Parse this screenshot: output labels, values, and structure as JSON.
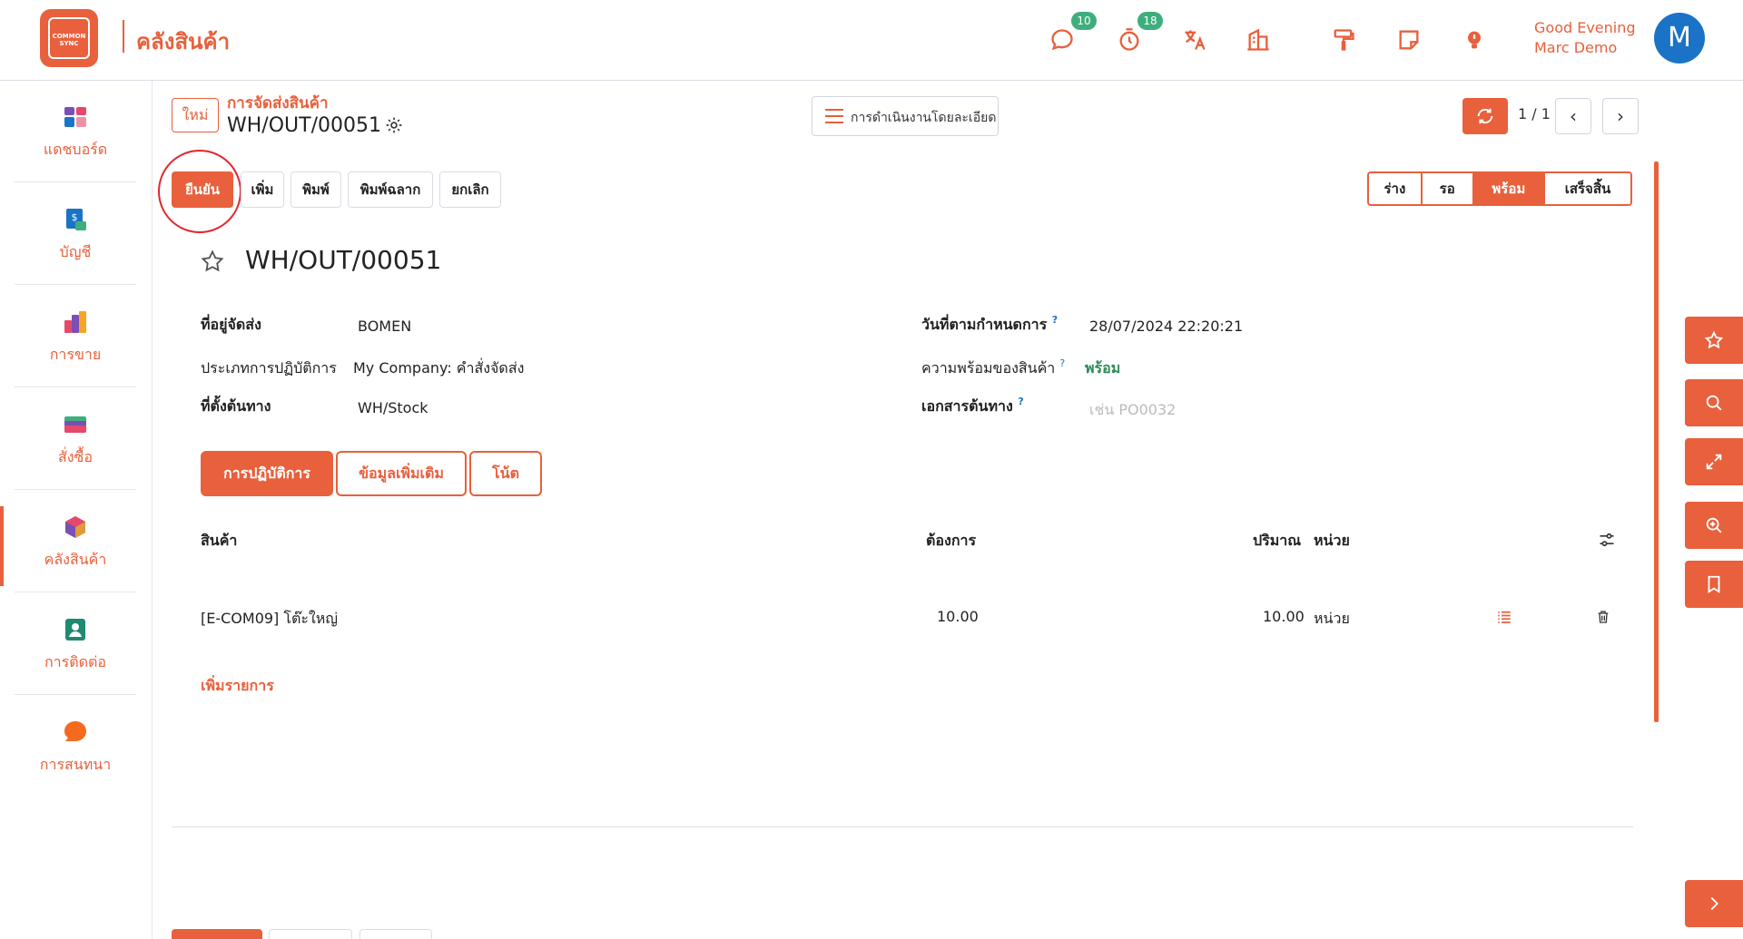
{
  "brand": {
    "logo_text": "COMMON SYNC",
    "app_title": "คลังสินค้า"
  },
  "topbar": {
    "chat_badge": "10",
    "timer_badge": "18",
    "greeting_line1": "Good Evening",
    "greeting_line2": "Marc Demo",
    "avatar_initial": "M"
  },
  "sidebar": {
    "items": [
      {
        "label": "แดชบอร์ด",
        "icon": "dashboard-icon"
      },
      {
        "label": "บัญชี",
        "icon": "accounting-icon"
      },
      {
        "label": "การขาย",
        "icon": "sales-icon"
      },
      {
        "label": "สั่งซื้อ",
        "icon": "purchase-icon"
      },
      {
        "label": "คลังสินค้า",
        "icon": "inventory-icon",
        "active": true
      },
      {
        "label": "การติดต่อ",
        "icon": "contacts-icon"
      },
      {
        "label": "การสนทนา",
        "icon": "discuss-icon"
      }
    ]
  },
  "header": {
    "new_label": "ใหม่",
    "breadcrumb": "การจัดส่งสินค้า",
    "record": "WH/OUT/00051",
    "detail_button": "การดำเนินงานโดยละเอียด",
    "pager": "1 / 1"
  },
  "actions": {
    "confirm": "ยืนยัน",
    "add": "เพิ่ม",
    "print": "พิมพ์",
    "print_label": "พิมพ์ฉลาก",
    "cancel": "ยกเลิก"
  },
  "status": {
    "steps": [
      "ร่าง",
      "รอ",
      "พร้อม",
      "เสร็จสิ้น"
    ],
    "active": "พร้อม"
  },
  "form": {
    "title": "WH/OUT/00051",
    "delivery_address_label": "ที่อยู่จัดส่ง",
    "delivery_address": "BOMEN",
    "operation_type_label": "ประเภทการปฏิบัติการ",
    "operation_type": "My Company: คำสั่งจัดส่ง",
    "source_location_label": "ที่ตั้งต้นทาง",
    "source_location": "WH/Stock",
    "scheduled_date_label": "วันที่ตามกำหนดการ",
    "scheduled_date": "28/07/2024 22:20:21",
    "readiness_label": "ความพร้อมของสินค้า",
    "readiness": "พร้อม",
    "source_doc_label": "เอกสารต้นทาง",
    "source_doc_placeholder": "เช่น PO0032",
    "help_mark": "?"
  },
  "tabs": [
    "การปฏิบัติการ",
    "ข้อมูลเพิ่มเติม",
    "โน้ต"
  ],
  "table": {
    "headers": {
      "product": "สินค้า",
      "demand": "ต้องการ",
      "quantity": "ปริมาณ",
      "unit": "หน่วย"
    },
    "rows": [
      {
        "product": "[E-COM09] โต๊ะใหญ่",
        "demand": "10.00",
        "quantity": "10.00",
        "unit": "หน่วย"
      }
    ],
    "add_line": "เพิ่มรายการ"
  },
  "colors": {
    "accent": "#e8603c",
    "badge": "#3fae7d",
    "avatar": "#1a73c7",
    "ready": "#2e8b57",
    "highlight": "#e2252b"
  }
}
